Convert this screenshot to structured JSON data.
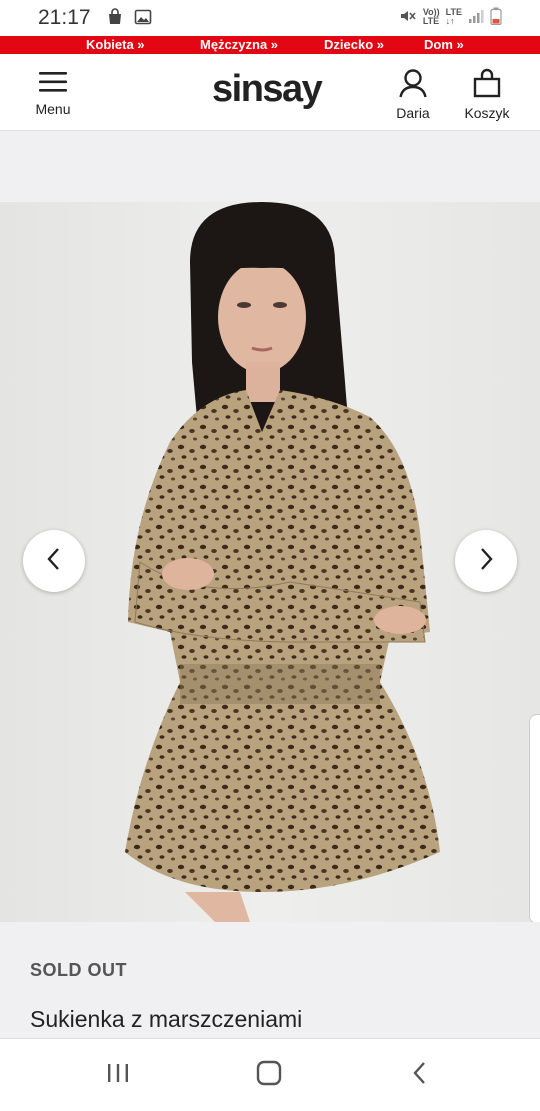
{
  "status_bar": {
    "time": "21:17",
    "volte": "Vo))",
    "lte_top": "LTE",
    "lte_left": "LTE",
    "lte_arrows": "↓↑"
  },
  "categories": [
    {
      "label": "Kobieta »"
    },
    {
      "label": "Mężczyzna »"
    },
    {
      "label": "Dziecko »"
    },
    {
      "label": "Dom »"
    }
  ],
  "header": {
    "menu_label": "Menu",
    "logo": "sinsay",
    "account_label": "Daria",
    "cart_label": "Koszyk"
  },
  "product": {
    "status": "SOLD OUT",
    "name": "Sukienka z marszczeniami"
  },
  "colors": {
    "brand_red": "#e30613",
    "background": "#f0f0f2"
  }
}
